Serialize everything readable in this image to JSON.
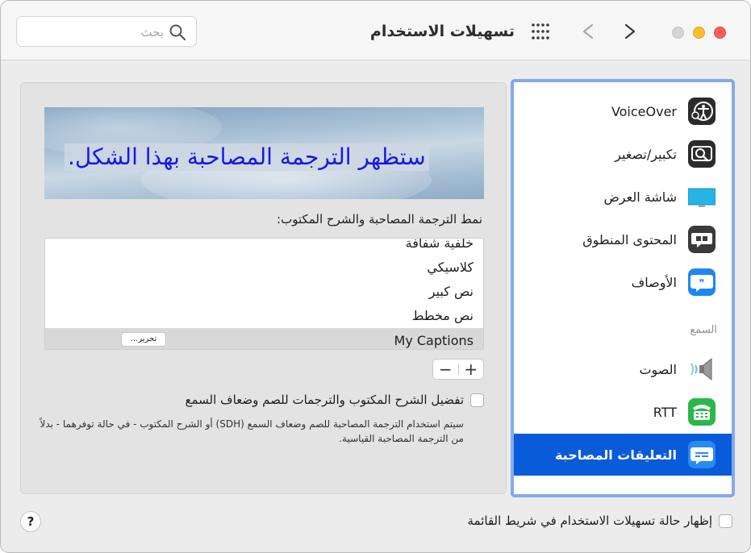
{
  "window": {
    "title": "تسهيلات الاستخدام",
    "search": {
      "placeholder": "بحث",
      "value": ""
    }
  },
  "sidebar": {
    "items": [
      {
        "label": "VoiceOver",
        "icon": "voiceover-icon"
      },
      {
        "label": "تكبير/تصغير",
        "icon": "zoom-icon"
      },
      {
        "label": "شاشة العرض",
        "icon": "display-icon"
      },
      {
        "label": "المحتوى المنطوق",
        "icon": "spoken-content-icon"
      },
      {
        "label": "الأوصاف",
        "icon": "descriptions-icon"
      }
    ],
    "section_hearing": "السمع",
    "hearing_items": [
      {
        "label": "الصوت",
        "icon": "audio-icon"
      },
      {
        "label": "RTT",
        "icon": "rtt-icon"
      },
      {
        "label": "التعليقات المصاحبة",
        "icon": "captions-icon",
        "selected": true
      }
    ]
  },
  "main": {
    "preview_text": "ستظهر الترجمة المصاحبة بهذا الشكل.",
    "style_label": "نمط الترجمة المصاحبة والشرح المكتوب:",
    "styles": [
      "خلفية شفافة",
      "كلاسيكي",
      "نص كبير",
      "نص مخطط",
      "My Captions"
    ],
    "selected_style": "My Captions",
    "edit_label": "تحرير...",
    "plus_label": "+",
    "minus_label": "−",
    "sdh_label": "تفضيل الشرح المكتوب والترجمات للصم وضعاف السمع",
    "sdh_checked": false,
    "sdh_description": "سيتم استخدام الترجمة المصاحبة للصم وضعاف السمع (SDH) أو الشرح المكتوب - في حالة توفرهما - بدلاً من الترجمة المصاحبة القياسية."
  },
  "footer": {
    "menubar_label": "إظهار حالة تسهيلات الاستخدام في شريط القائمة",
    "menubar_checked": false,
    "help_label": "?"
  },
  "colors": {
    "selection": "#0a5bd9",
    "sidebar_focus": "#83a9ea",
    "caption_text": "#1717e6"
  }
}
